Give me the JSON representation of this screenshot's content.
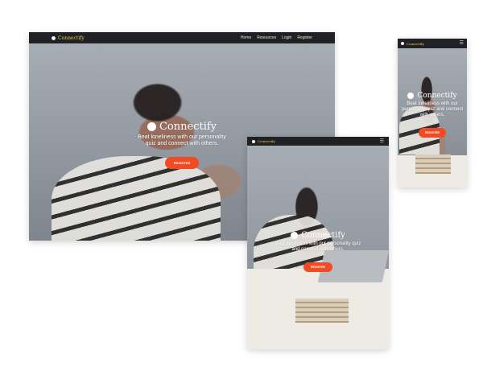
{
  "brand": {
    "name": "Connectify"
  },
  "nav": {
    "links": [
      "Home",
      "Resources",
      "Login",
      "Register"
    ],
    "menu_icon": "hamburger-icon"
  },
  "hero": {
    "title": "Connectify",
    "subtitle": "Beat loneliness with our personality quiz and connect with others.",
    "cta_label": "REGISTER"
  },
  "colors": {
    "navbar": "#1f2124",
    "brand": "#f2c84b",
    "cta": "#f04b23"
  }
}
